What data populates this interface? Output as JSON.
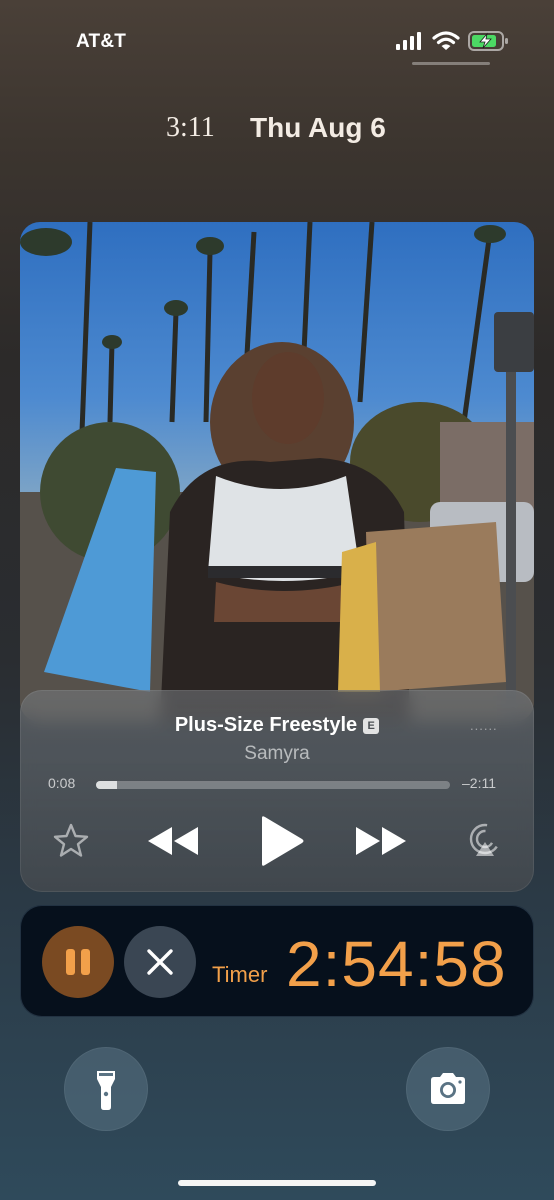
{
  "status_bar": {
    "carrier": "AT&T",
    "icons": [
      "cellular-signal-icon",
      "wifi-icon",
      "battery-charging-icon"
    ]
  },
  "lock_screen": {
    "time": "3:11",
    "date": "Thu Aug 6"
  },
  "now_playing": {
    "artwork": "album-artwork",
    "title": "Plus-Size Freestyle",
    "explicit_badge": "E",
    "artist": "Samyra",
    "more_indicator": "......",
    "elapsed": "0:08",
    "remaining": "–2:11",
    "progress": 0.06,
    "controls": [
      "star-icon",
      "rewind-icon",
      "play-icon",
      "fast-forward-icon",
      "airplay-icon"
    ]
  },
  "timer_activity": {
    "label": "Timer",
    "value": "2:54:58",
    "accent_color": "#f2a04a",
    "controls": [
      "pause-icon",
      "close-icon"
    ]
  },
  "quick_actions": [
    "flashlight-icon",
    "camera-icon"
  ]
}
